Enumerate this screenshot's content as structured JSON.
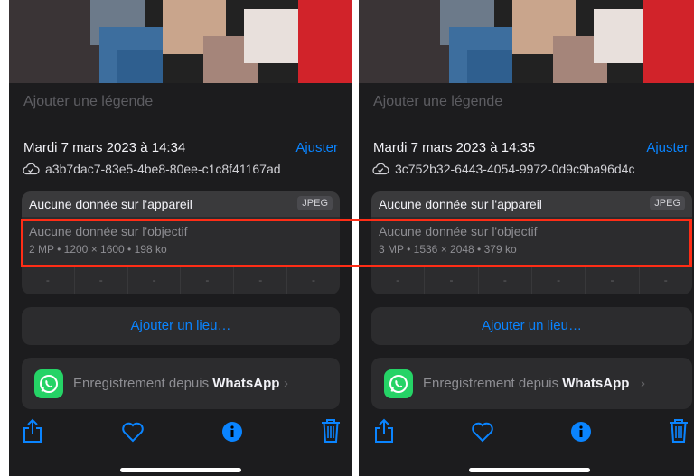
{
  "colors": {
    "accent": "#0a84ff",
    "highlight": "#ff2d16",
    "whatsapp": "#25d366"
  },
  "panels": [
    {
      "caption_placeholder": "Ajouter une légende",
      "date": "Mardi 7 mars 2023 à 14:34",
      "adjust_label": "Ajuster",
      "identifier": "a3b7dac7-83e5-4be8-80ee-c1c8f41167ad",
      "device_label": "Aucune donnée sur l'appareil",
      "format_badge": "JPEG",
      "lens_label": "Aucune donnée sur l'objectif",
      "specs": "2 MP • 1200 × 1600 • 198 ko",
      "exif": [
        "-",
        "-",
        "-",
        "-",
        "-",
        "-"
      ],
      "add_place_label": "Ajouter un lieu…",
      "source_prefix": "Enregistrement depuis",
      "source_app": "WhatsApp"
    },
    {
      "caption_placeholder": "Ajouter une légende",
      "date": "Mardi 7 mars 2023 à 14:35",
      "adjust_label": "Ajuster",
      "identifier": "3c752b32-6443-4054-9972-0d9c9ba96d4c",
      "device_label": "Aucune donnée sur l'appareil",
      "format_badge": "JPEG",
      "lens_label": "Aucune donnée sur l'objectif",
      "specs": "3 MP • 1536 × 2048 • 379 ko",
      "exif": [
        "-",
        "-",
        "-",
        "-",
        "-",
        "-"
      ],
      "add_place_label": "Ajouter un lieu…",
      "source_prefix": "Enregistrement depuis",
      "source_app": "WhatsApp"
    }
  ],
  "toolbar_icons": [
    "share-icon",
    "heart-icon",
    "info-icon",
    "trash-icon"
  ]
}
